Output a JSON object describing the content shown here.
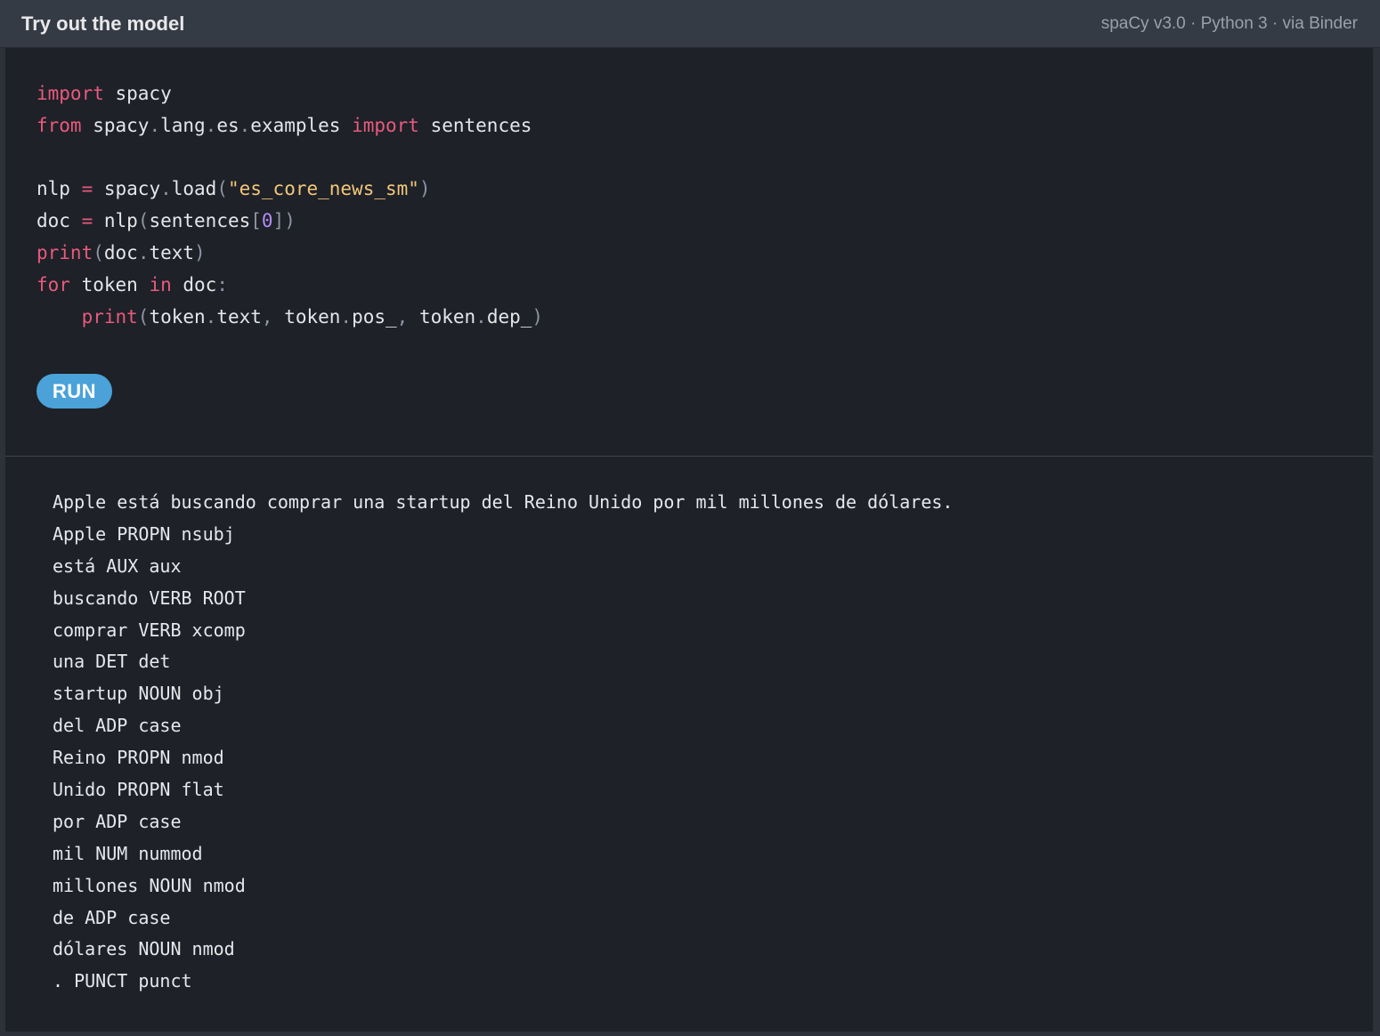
{
  "header": {
    "title": "Try out the model",
    "meta": "spaCy v3.0 · Python 3 · via Binder"
  },
  "editor": {
    "lines": [
      [
        {
          "t": "import",
          "c": "kw"
        },
        {
          "t": " spacy",
          "c": ""
        }
      ],
      [
        {
          "t": "from",
          "c": "kw"
        },
        {
          "t": " spacy",
          "c": ""
        },
        {
          "t": ".",
          "c": "pun"
        },
        {
          "t": "lang",
          "c": ""
        },
        {
          "t": ".",
          "c": "pun"
        },
        {
          "t": "es",
          "c": ""
        },
        {
          "t": ".",
          "c": "pun"
        },
        {
          "t": "examples ",
          "c": ""
        },
        {
          "t": "import",
          "c": "kw"
        },
        {
          "t": " sentences",
          "c": ""
        }
      ],
      [],
      [
        {
          "t": "nlp ",
          "c": ""
        },
        {
          "t": "=",
          "c": "kw"
        },
        {
          "t": " spacy",
          "c": ""
        },
        {
          "t": ".",
          "c": "pun"
        },
        {
          "t": "load",
          "c": ""
        },
        {
          "t": "(",
          "c": "pun"
        },
        {
          "t": "\"es_core_news_sm\"",
          "c": "str"
        },
        {
          "t": ")",
          "c": "pun"
        }
      ],
      [
        {
          "t": "doc ",
          "c": ""
        },
        {
          "t": "=",
          "c": "kw"
        },
        {
          "t": " nlp",
          "c": ""
        },
        {
          "t": "(",
          "c": "pun"
        },
        {
          "t": "sentences",
          "c": ""
        },
        {
          "t": "[",
          "c": "pun"
        },
        {
          "t": "0",
          "c": "num"
        },
        {
          "t": "])",
          "c": "pun"
        }
      ],
      [
        {
          "t": "print",
          "c": "kw"
        },
        {
          "t": "(",
          "c": "pun"
        },
        {
          "t": "doc",
          "c": ""
        },
        {
          "t": ".",
          "c": "pun"
        },
        {
          "t": "text",
          "c": ""
        },
        {
          "t": ")",
          "c": "pun"
        }
      ],
      [
        {
          "t": "for",
          "c": "kw"
        },
        {
          "t": " token ",
          "c": ""
        },
        {
          "t": "in",
          "c": "kw"
        },
        {
          "t": " doc",
          "c": ""
        },
        {
          "t": ":",
          "c": "pun"
        }
      ],
      [
        {
          "t": "    ",
          "c": ""
        },
        {
          "t": "print",
          "c": "kw"
        },
        {
          "t": "(",
          "c": "pun"
        },
        {
          "t": "token",
          "c": ""
        },
        {
          "t": ".",
          "c": "pun"
        },
        {
          "t": "text",
          "c": ""
        },
        {
          "t": ", ",
          "c": "pun"
        },
        {
          "t": "token",
          "c": ""
        },
        {
          "t": ".",
          "c": "pun"
        },
        {
          "t": "pos_",
          "c": ""
        },
        {
          "t": ", ",
          "c": "pun"
        },
        {
          "t": "token",
          "c": ""
        },
        {
          "t": ".",
          "c": "pun"
        },
        {
          "t": "dep_",
          "c": ""
        },
        {
          "t": ")",
          "c": "pun"
        }
      ]
    ],
    "run_label": "RUN"
  },
  "output": {
    "lines": [
      "Apple está buscando comprar una startup del Reino Unido por mil millones de dólares.",
      "Apple PROPN nsubj",
      "está AUX aux",
      "buscando VERB ROOT",
      "comprar VERB xcomp",
      "una DET det",
      "startup NOUN obj",
      "del ADP case",
      "Reino PROPN nmod",
      "Unido PROPN flat",
      "por ADP case",
      "mil NUM nummod",
      "millones NOUN nmod",
      "de ADP case",
      "dólares NOUN nmod",
      ". PUNCT punct"
    ]
  },
  "colors": {
    "keyword": "#e85a7d",
    "string": "#f2c77b",
    "number": "#b38af5",
    "run_button": "#4aa2d9"
  }
}
